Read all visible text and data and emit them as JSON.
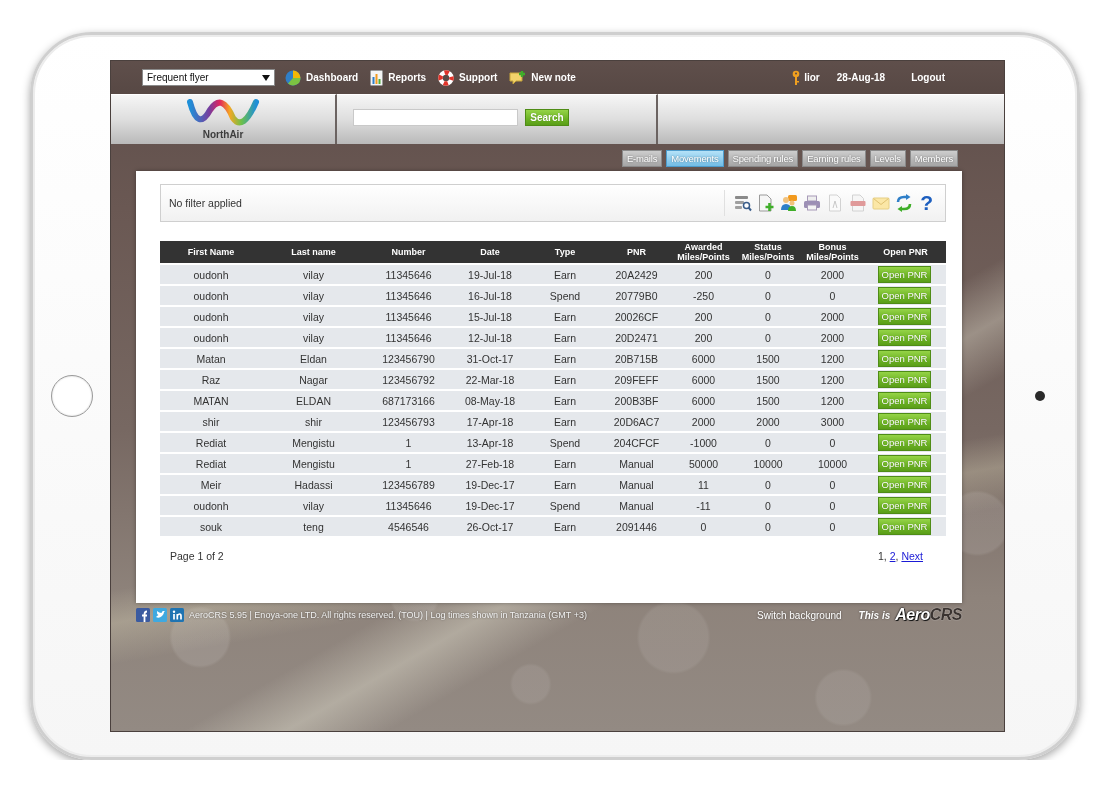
{
  "module_select": {
    "value": "Frequent flyer"
  },
  "nav": [
    {
      "label": "Dashboard"
    },
    {
      "label": "Reports"
    },
    {
      "label": "Support"
    },
    {
      "label": "New note"
    }
  ],
  "user": {
    "name": "lior",
    "date": "28-Aug-18",
    "logout": "Logout"
  },
  "brand": {
    "name": "NorthAir"
  },
  "search": {
    "button": "Search"
  },
  "tabs": [
    {
      "label": "E-mails",
      "selected": false
    },
    {
      "label": "Movements",
      "selected": true
    },
    {
      "label": "Spending rules",
      "selected": false
    },
    {
      "label": "Earning rules",
      "selected": false
    },
    {
      "label": "Levels",
      "selected": false
    },
    {
      "label": "Members",
      "selected": false
    }
  ],
  "filter": {
    "status": "No filter applied",
    "help": "?"
  },
  "table": {
    "columns": [
      "First Name",
      "Last name",
      "Number",
      "Date",
      "Type",
      "PNR",
      "Awarded Miles/Points",
      "Status Miles/Points",
      "Bonus Miles/Points",
      "Open PNR"
    ],
    "rows": [
      {
        "cells": [
          "oudonh",
          "vilay",
          "11345646",
          "19-Jul-18",
          "Earn",
          "20A2429",
          "200",
          "0",
          "2000"
        ],
        "action": "Open PNR"
      },
      {
        "cells": [
          "oudonh",
          "vilay",
          "11345646",
          "16-Jul-18",
          "Spend",
          "20779B0",
          "-250",
          "0",
          "0"
        ],
        "action": "Open PNR"
      },
      {
        "cells": [
          "oudonh",
          "vilay",
          "11345646",
          "15-Jul-18",
          "Earn",
          "20026CF",
          "200",
          "0",
          "2000"
        ],
        "action": "Open PNR"
      },
      {
        "cells": [
          "oudonh",
          "vilay",
          "11345646",
          "12-Jul-18",
          "Earn",
          "20D2471",
          "200",
          "0",
          "2000"
        ],
        "action": "Open PNR"
      },
      {
        "cells": [
          "Matan",
          "Eldan",
          "123456790",
          "31-Oct-17",
          "Earn",
          "20B715B",
          "6000",
          "1500",
          "1200"
        ],
        "action": "Open PNR"
      },
      {
        "cells": [
          "Raz",
          "Nagar",
          "123456792",
          "22-Mar-18",
          "Earn",
          "209FEFF",
          "6000",
          "1500",
          "1200"
        ],
        "action": "Open PNR"
      },
      {
        "cells": [
          "MATAN",
          "ELDAN",
          "687173166",
          "08-May-18",
          "Earn",
          "200B3BF",
          "6000",
          "1500",
          "1200"
        ],
        "action": "Open PNR"
      },
      {
        "cells": [
          "shir",
          "shir",
          "123456793",
          "17-Apr-18",
          "Earn",
          "20D6AC7",
          "2000",
          "2000",
          "3000"
        ],
        "action": "Open PNR"
      },
      {
        "cells": [
          "Rediat",
          "Mengistu",
          "1",
          "13-Apr-18",
          "Spend",
          "204CFCF",
          "-1000",
          "0",
          "0"
        ],
        "action": "Open PNR"
      },
      {
        "cells": [
          "Rediat",
          "Mengistu",
          "1",
          "27-Feb-18",
          "Earn",
          "Manual",
          "50000",
          "10000",
          "10000"
        ],
        "action": "Open PNR"
      },
      {
        "cells": [
          "Meir",
          "Hadassi",
          "123456789",
          "19-Dec-17",
          "Earn",
          "Manual",
          "11",
          "0",
          "0"
        ],
        "action": "Open PNR"
      },
      {
        "cells": [
          "oudonh",
          "vilay",
          "11345646",
          "19-Dec-17",
          "Spend",
          "Manual",
          "-11",
          "0",
          "0"
        ],
        "action": "Open PNR"
      },
      {
        "cells": [
          "souk",
          "teng",
          "4546546",
          "26-Oct-17",
          "Earn",
          "2091446",
          "0",
          "0",
          "0"
        ],
        "action": "Open PNR"
      }
    ]
  },
  "pagination": {
    "summary": "Page 1 of 2",
    "separator": ",",
    "pages": [
      {
        "label": "1",
        "selected": true
      },
      {
        "label": "2",
        "selected": false
      }
    ],
    "next": "Next"
  },
  "footer": {
    "text": "AeroCRS 5.95 | Enoya-one LTD. All rights reserved. (TOU) | Log times shown in Tanzania (GMT +3)",
    "switch": "Switch background",
    "tagline": "This is",
    "logo": "**Aero**CRS"
  }
}
